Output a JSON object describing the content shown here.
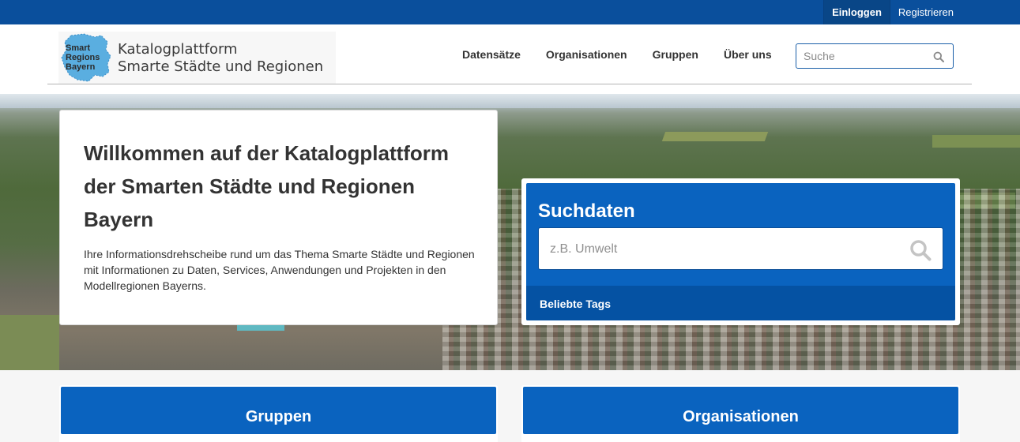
{
  "topbar": {
    "login_label": "Einloggen",
    "register_label": "Registrieren"
  },
  "header": {
    "logo": {
      "mark_text": [
        "Smart",
        "Regions",
        "Bayern"
      ],
      "title_line1": "Katalogplattform",
      "title_line2": "Smarte Städte und Regionen"
    },
    "nav": [
      "Datensätze",
      "Organisationen",
      "Gruppen",
      "Über uns"
    ],
    "search_placeholder": "Suche"
  },
  "hero": {
    "welcome": {
      "title": "Willkommen auf der Katalogplattform der Smarten Städte und Regionen Bayern",
      "text": "Ihre Informationsdrehscheibe rund um das Thema Smarte Städte und Regionen mit Informationen zu Daten, Services, Anwendungen und Projekten in den Modellregionen Bayerns."
    },
    "search": {
      "title": "Suchdaten",
      "placeholder": "z.B. Umwelt",
      "tags_label": "Beliebte Tags"
    }
  },
  "cards": {
    "left_title": "Gruppen",
    "right_title": "Organisationen"
  },
  "colors": {
    "topbar": "#0a4f9c",
    "primary": "#0a63bf",
    "tags_band": "#0552a3"
  }
}
